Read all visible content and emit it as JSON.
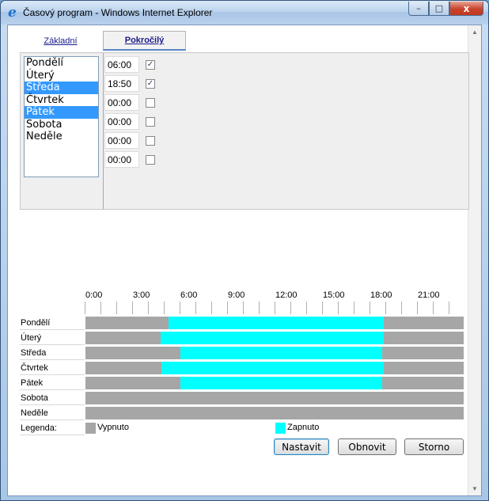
{
  "window": {
    "title": "Časový program - Windows Internet Explorer",
    "icon": "ie-icon"
  },
  "tabs": [
    {
      "label": "Základní",
      "active": false
    },
    {
      "label": "Pokročilý",
      "active": true
    }
  ],
  "days_list": [
    {
      "label": "Pondělí",
      "selected": false
    },
    {
      "label": "Úterý",
      "selected": false
    },
    {
      "label": "Středa",
      "selected": true
    },
    {
      "label": "Čtvrtek",
      "selected": false
    },
    {
      "label": "Pátek",
      "selected": true
    },
    {
      "label": "Sobota",
      "selected": false
    },
    {
      "label": "Neděle",
      "selected": false
    }
  ],
  "times": [
    {
      "value": "06:00",
      "checked": true
    },
    {
      "value": "18:50",
      "checked": true
    },
    {
      "value": "00:00",
      "checked": false
    },
    {
      "value": "00:00",
      "checked": false
    },
    {
      "value": "00:00",
      "checked": false
    },
    {
      "value": "00:00",
      "checked": false
    }
  ],
  "schedule": {
    "hour_labels": [
      "0:00",
      "3:00",
      "6:00",
      "9:00",
      "12:00",
      "15:00",
      "18:00",
      "21:00"
    ],
    "rows": [
      {
        "day": "Pondělí",
        "on_start": "05:15",
        "on_end": "18:55"
      },
      {
        "day": "Úterý",
        "on_start": "04:45",
        "on_end": "18:55"
      },
      {
        "day": "Středa",
        "on_start": "06:00",
        "on_end": "18:50"
      },
      {
        "day": "Čtvrtek",
        "on_start": "04:50",
        "on_end": "18:55"
      },
      {
        "day": "Pátek",
        "on_start": "06:00",
        "on_end": "18:50"
      },
      {
        "day": "Sobota",
        "on_start": null,
        "on_end": null
      },
      {
        "day": "Neděle",
        "on_start": null,
        "on_end": null
      }
    ],
    "legend_label": "Legenda:",
    "legend_off": "Vypnuto",
    "legend_on": "Zapnuto",
    "color_off": "#a6a6a6",
    "color_on": "#00ffff"
  },
  "buttons": {
    "set": "Nastavit",
    "refresh": "Obnovit",
    "cancel": "Storno"
  },
  "window_buttons": {
    "minimize": "–",
    "maximize": "□",
    "close": "x"
  }
}
